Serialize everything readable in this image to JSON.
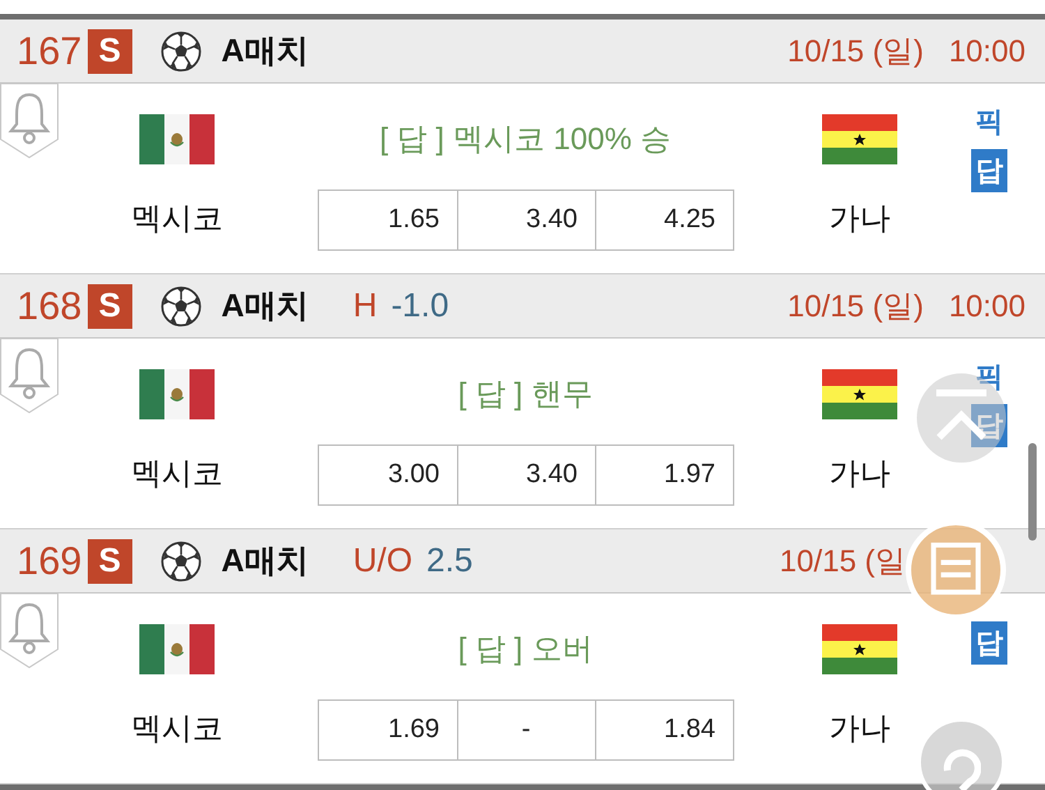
{
  "matches": [
    {
      "number": "167",
      "sport_badge": "S",
      "league": "A매치",
      "date": "10/15 (일)",
      "time": "10:00",
      "home": "멕시코",
      "away": "가나",
      "answer": "[ 답 ]  멕시코 100% 승",
      "odds": [
        "1.65",
        "3.40",
        "4.25"
      ],
      "pick": "픽",
      "pick_badge": "답"
    },
    {
      "number": "168",
      "sport_badge": "S",
      "league": "A매치",
      "hint": {
        "label": "H",
        "value": "-1.0"
      },
      "date": "10/15 (일)",
      "time": "10:00",
      "home": "멕시코",
      "away": "가나",
      "answer": "[ 답 ] 핸무",
      "odds": [
        "3.00",
        "3.40",
        "1.97"
      ],
      "pick": "픽",
      "pick_badge": "답"
    },
    {
      "number": "169",
      "sport_badge": "S",
      "league": "A매치",
      "hint": {
        "label": "U/O",
        "value": "2.5"
      },
      "date": "10/15 (일",
      "home": "멕시코",
      "away": "가나",
      "answer": "[ 답 ] 오버",
      "odds": [
        "1.69",
        "-",
        "1.84"
      ],
      "pick_badge": "답"
    }
  ]
}
